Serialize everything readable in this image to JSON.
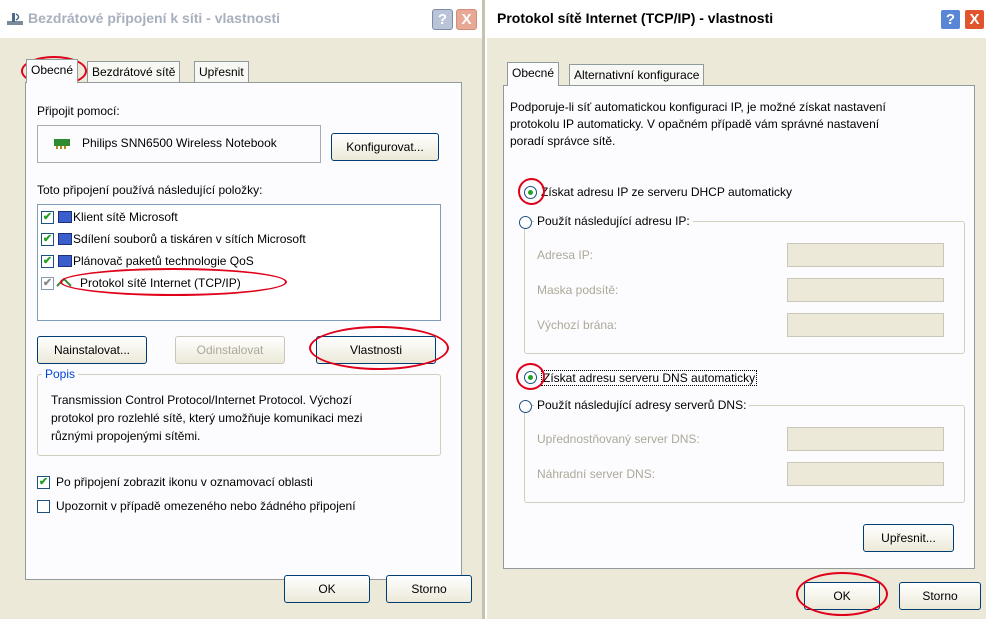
{
  "left_window": {
    "title": "Bezdrátové připojení k síti - vlastnosti",
    "help_icon": "?",
    "close_icon": "X",
    "tabs": [
      "Obecné",
      "Bezdrátové sítě",
      "Upřesnit"
    ],
    "connect_using_label": "Připojit pomocí:",
    "adapter_name": "Philips SNN6500 Wireless Notebook",
    "configure_button": "Konfigurovat...",
    "items_label": "Toto připojení používá následující položky:",
    "items": [
      {
        "label": "Klient sítě Microsoft",
        "checked": true
      },
      {
        "label": "Sdílení souborů a tiskáren v sítích Microsoft",
        "checked": true
      },
      {
        "label": "Plánovač paketů technologie QoS",
        "checked": true
      },
      {
        "label": "Protokol sítě Internet (TCP/IP)",
        "checked": true
      }
    ],
    "install_button": "Nainstalovat...",
    "uninstall_button": "Odinstalovat",
    "properties_button": "Vlastnosti",
    "description_legend": "Popis",
    "description_lines": [
      "Transmission Control Protocol/Internet Protocol. Výchozí",
      "protokol pro rozlehlé sítě, který umožňuje komunikaci mezi",
      "různými propojenými sítěmi."
    ],
    "show_icon_label": "Po připojení zobrazit ikonu v oznamovací oblasti",
    "show_icon_checked": true,
    "notify_label": "Upozornit v případě omezeného nebo žádného připojení",
    "notify_checked": false,
    "ok_button": "OK",
    "cancel_button": "Storno"
  },
  "right_window": {
    "title": "Protokol sítě Internet (TCP/IP) - vlastnosti",
    "help_icon": "?",
    "close_icon": "X",
    "tabs": [
      "Obecné",
      "Alternativní konfigurace"
    ],
    "intro_lines": [
      "Podporuje-li síť automatickou konfiguraci IP, je možné získat nastavení",
      "protokolu IP automaticky. V opačném případě vám správné nastavení",
      "poradí správce sítě."
    ],
    "auto_ip_label": "Získat adresu IP ze serveru DHCP automaticky",
    "manual_ip_label": "Použít následující adresu IP:",
    "ip_address_label": "Adresa IP:",
    "subnet_mask_label": "Maska podsítě:",
    "gateway_label": "Výchozí brána:",
    "auto_dns_label": "Získat adresu serveru DNS automaticky",
    "manual_dns_label": "Použít následující adresy serverů DNS:",
    "preferred_dns_label": "Upřednostňovaný server DNS:",
    "alternate_dns_label": "Náhradní server DNS:",
    "advanced_button": "Upřesnit...",
    "ok_button": "OK",
    "cancel_button": "Storno"
  },
  "colors": {
    "dialog_bg": "#ece9d8",
    "panel_bg": "#fcfcfe",
    "annotation_red": "#e0001a",
    "check_green": "#21a121",
    "close_red": "#e0552e"
  }
}
